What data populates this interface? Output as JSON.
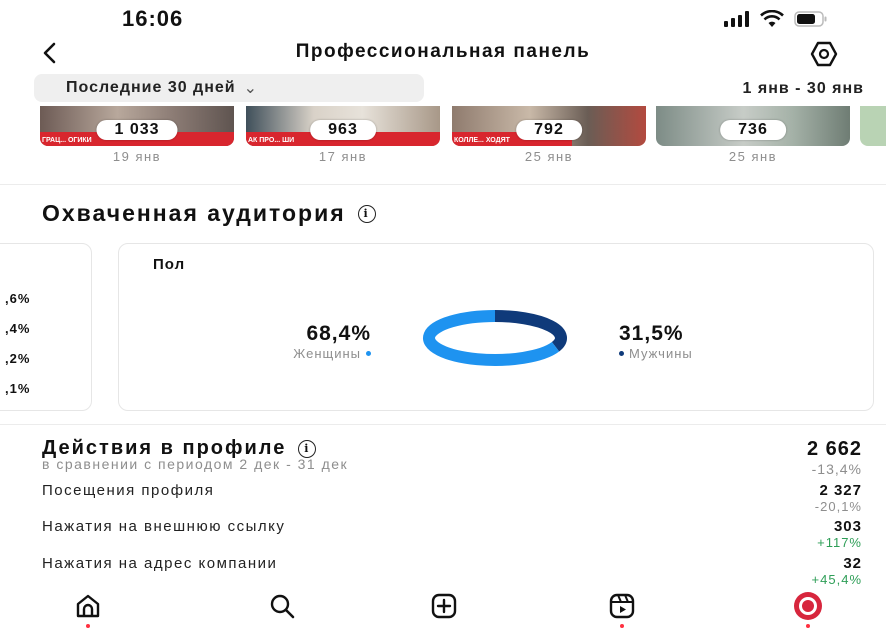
{
  "status_bar": {
    "time": "16:06"
  },
  "header": {
    "title": "Профессиональная панель"
  },
  "filter": {
    "period": "Последние 30 дней",
    "range": "1 янв - 30 янв"
  },
  "reels": [
    {
      "count": "1 033",
      "date": "19 янв",
      "thumb_text": "ГРАЦ... ОГИКИ"
    },
    {
      "count": "963",
      "date": "17 янв",
      "thumb_text": "АК ПРО... ШИ"
    },
    {
      "count": "792",
      "date": "25 янв",
      "thumb_text": "КОЛЛЕ... ХОДЯТ"
    },
    {
      "count": "736",
      "date": "25 янв",
      "thumb_text": ""
    }
  ],
  "audience": {
    "title": "Охваченная аудитория",
    "age_values": [
      ",6%",
      ",4%",
      ",2%",
      ",1%"
    ],
    "gender": {
      "title": "Пол",
      "female_pct": "68,4%",
      "female_label": "Женщины",
      "male_pct": "31,5%",
      "male_label": "Мужчины",
      "female_share": 68.4,
      "male_share": 31.5,
      "female_color": "#1e93f0",
      "male_color": "#0f3a7a"
    }
  },
  "profile_actions": {
    "title": "Действия в профиле",
    "subtitle": "в сравнении с периодом 2 дек - 31 дек",
    "total": "2 662",
    "total_delta": "-13,4%",
    "rows": [
      {
        "label": "Посещения профиля",
        "value": "2 327",
        "delta": "-20,1%",
        "delta_color": "#8e8e8e"
      },
      {
        "label": "Нажатия на внешнюю ссылку",
        "value": "303",
        "delta": "+117%",
        "delta_color": "#2e9e57"
      },
      {
        "label": "Нажатия на адрес компании",
        "value": "32",
        "delta": "+45,4%",
        "delta_color": "#2e9e57"
      }
    ]
  },
  "tabs": [
    {
      "icon": "home-icon"
    },
    {
      "icon": "search-icon"
    },
    {
      "icon": "create-icon"
    },
    {
      "icon": "reels-icon"
    },
    {
      "icon": "profile-avatar"
    }
  ]
}
